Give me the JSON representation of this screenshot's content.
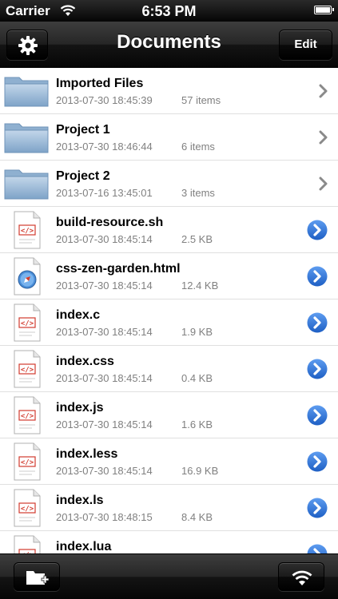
{
  "status_bar": {
    "carrier": "Carrier",
    "time": "6:53 PM",
    "wifi_icon": "wifi-icon",
    "battery_icon": "battery-icon"
  },
  "nav_bar": {
    "title": "Documents",
    "settings_icon": "gear-icon",
    "edit_label": "Edit"
  },
  "items": [
    {
      "name": "Imported Files",
      "date": "2013-07-30 18:45:39",
      "meta": "57 items",
      "kind": "folder"
    },
    {
      "name": "Project 1",
      "date": "2013-07-30 18:46:44",
      "meta": "6 items",
      "kind": "folder"
    },
    {
      "name": "Project 2",
      "date": "2013-07-16 13:45:01",
      "meta": "3 items",
      "kind": "folder"
    },
    {
      "name": "build-resource.sh",
      "date": "2013-07-30 18:45:14",
      "meta": "2.5 KB",
      "kind": "code"
    },
    {
      "name": "css-zen-garden.html",
      "date": "2013-07-30 18:45:14",
      "meta": "12.4 KB",
      "kind": "html"
    },
    {
      "name": "index.c",
      "date": "2013-07-30 18:45:14",
      "meta": "1.9 KB",
      "kind": "code"
    },
    {
      "name": "index.css",
      "date": "2013-07-30 18:45:14",
      "meta": "0.4 KB",
      "kind": "code"
    },
    {
      "name": "index.js",
      "date": "2013-07-30 18:45:14",
      "meta": "1.6 KB",
      "kind": "code"
    },
    {
      "name": "index.less",
      "date": "2013-07-30 18:45:14",
      "meta": "16.9 KB",
      "kind": "code"
    },
    {
      "name": "index.ls",
      "date": "2013-07-30 18:48:15",
      "meta": "8.4 KB",
      "kind": "code"
    },
    {
      "name": "index.lua",
      "date": "",
      "meta": "",
      "kind": "code"
    }
  ],
  "toolbar": {
    "new_folder_icon": "new-folder-icon",
    "wifi_share_icon": "wifi-icon"
  },
  "colors": {
    "disclosure_blue": "#2a6fd6",
    "chevron_gray": "#8a8a8a",
    "code_red": "#d23b2e",
    "folder_blue": "#9ab8d6"
  }
}
